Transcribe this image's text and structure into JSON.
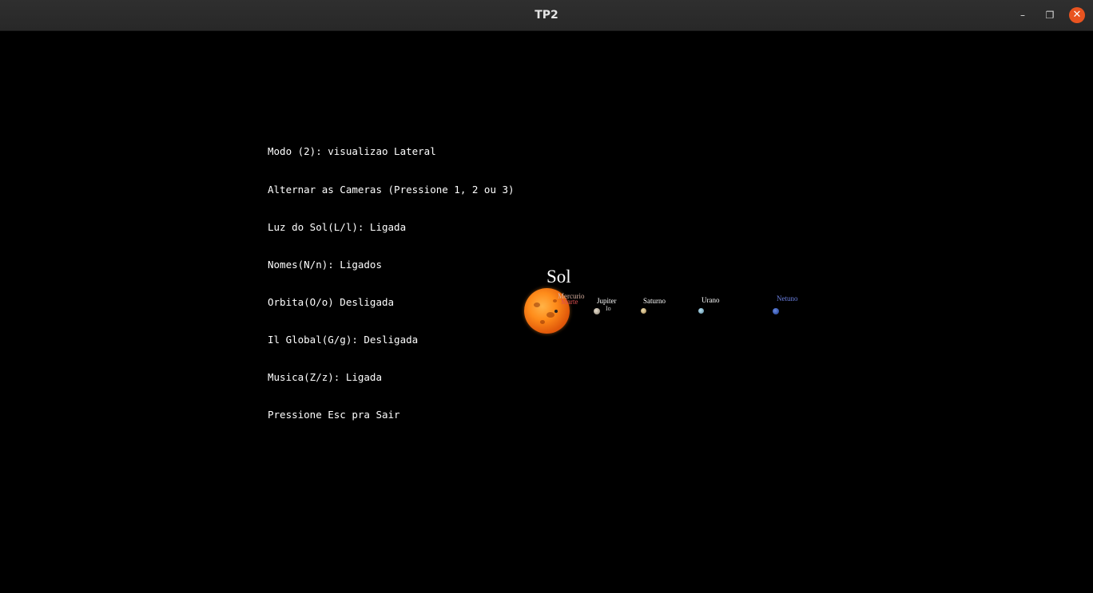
{
  "window": {
    "title": "TP2",
    "buttons": {
      "minimize": "–",
      "maximize": "❐",
      "close": "✕"
    }
  },
  "info_lines": [
    "Modo (2): visualizao Lateral",
    "Alternar as Cameras (Pressione 1, 2 ou 3)",
    "Luz do Sol(L/l): Ligada",
    "Nomes(N/n): Ligados",
    "Orbita(O/o) Desligada",
    "Il Global(G/g): Desligada",
    "Musica(Z/z): Ligada",
    "Pressione Esc pra Sair"
  ],
  "scene": {
    "sun_label": "Sol",
    "planet_labels": {
      "mercurio": "Mercurio",
      "marte": "Marte",
      "jupiter": "Jupiter",
      "io": "Io",
      "saturno": "Saturno",
      "urano": "Urano",
      "netuno": "Netuno"
    },
    "colors": {
      "background": "#000000",
      "sun": "#ff8c1a",
      "marte_label": "#e05050",
      "netuno_label": "#6a7fe0",
      "label_default": "#ffffff"
    }
  }
}
